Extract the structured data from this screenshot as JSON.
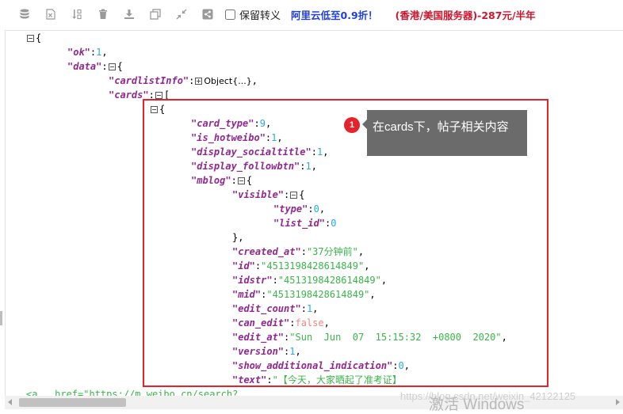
{
  "toolbar": {
    "icons": [
      "database-icon",
      "excel-icon",
      "sort-icon",
      "trash-icon",
      "download-icon",
      "copy-icon",
      "compress-icon",
      "share-icon"
    ],
    "checkbox_label": "保留转义",
    "promo_a": "阿里云低至0.9折！",
    "promo_b": "(香港/美国服务器)-287元/半年"
  },
  "json_lines": [
    {
      "text": "{",
      "indent": 0,
      "fold": true
    },
    {
      "key": "\"ok\"",
      "value": "1",
      "vtype": "n",
      "comma": true,
      "indent": 1
    },
    {
      "key": "\"data\"",
      "value": "{",
      "fold": true,
      "indent": 1
    },
    {
      "key": "\"cardlistInfo\"",
      "value": "Object{...}",
      "vtype": "obj",
      "foldPlus": true,
      "comma": true,
      "indent": 2
    },
    {
      "key": "\"cards\"",
      "value": "[",
      "fold": true,
      "indent": 2
    },
    {
      "text": "{",
      "indent": 3,
      "fold": true
    },
    {
      "key": "\"card_type\"",
      "value": "9",
      "vtype": "n",
      "comma": true,
      "indent": 4
    },
    {
      "key": "\"is_hotweibo\"",
      "value": "1",
      "vtype": "n",
      "comma": true,
      "indent": 4
    },
    {
      "key": "\"display_socialtitle\"",
      "value": "1",
      "vtype": "n",
      "comma": true,
      "indent": 4
    },
    {
      "key": "\"display_followbtn\"",
      "value": "1",
      "vtype": "n",
      "comma": true,
      "indent": 4
    },
    {
      "key": "\"mblog\"",
      "value": "{",
      "fold": true,
      "indent": 4
    },
    {
      "key": "\"visible\"",
      "value": "{",
      "fold": true,
      "indent": 5
    },
    {
      "key": "\"type\"",
      "value": "0",
      "vtype": "n",
      "comma": true,
      "indent": 6
    },
    {
      "key": "\"list_id\"",
      "value": "0",
      "vtype": "n",
      "indent": 6
    },
    {
      "text": "},",
      "indent": 5
    },
    {
      "key": "\"created_at\"",
      "value": "\"37分钟前\"",
      "vtype": "s",
      "comma": true,
      "indent": 5
    },
    {
      "key": "\"id\"",
      "value": "\"4513198428614849\"",
      "vtype": "s",
      "comma": true,
      "indent": 5
    },
    {
      "key": "\"idstr\"",
      "value": "\"4513198428614849\"",
      "vtype": "s",
      "comma": true,
      "indent": 5
    },
    {
      "key": "\"mid\"",
      "value": "\"4513198428614849\"",
      "vtype": "s",
      "comma": true,
      "indent": 5
    },
    {
      "key": "\"edit_count\"",
      "value": "1",
      "vtype": "n",
      "comma": true,
      "indent": 5
    },
    {
      "key": "\"can_edit\"",
      "value": "false",
      "vtype": "b",
      "comma": true,
      "indent": 5
    },
    {
      "key": "\"edit_at\"",
      "value": "\"Sun  Jun  07  15:15:32  +0800  2020\"",
      "vtype": "s",
      "comma": true,
      "indent": 5
    },
    {
      "key": "\"version\"",
      "value": "1",
      "vtype": "n",
      "comma": true,
      "indent": 5
    },
    {
      "key": "\"show_additional_indication\"",
      "value": "0",
      "vtype": "n",
      "comma": true,
      "indent": 5
    },
    {
      "key": "\"text\"",
      "value": "\"【今天，大家晒起了准考证】",
      "vtype": "s",
      "indent": 5
    },
    {
      "text": "<a   href=\"https://m.weibo.cn/search?",
      "vtype": "s",
      "indent": 0
    }
  ],
  "annotation": {
    "badge": "1",
    "tooltip": "在cards下，帖子相关内容"
  },
  "watermark": "https://blog.csdn.net/weixin_42122125",
  "activate": "激活 Windows"
}
